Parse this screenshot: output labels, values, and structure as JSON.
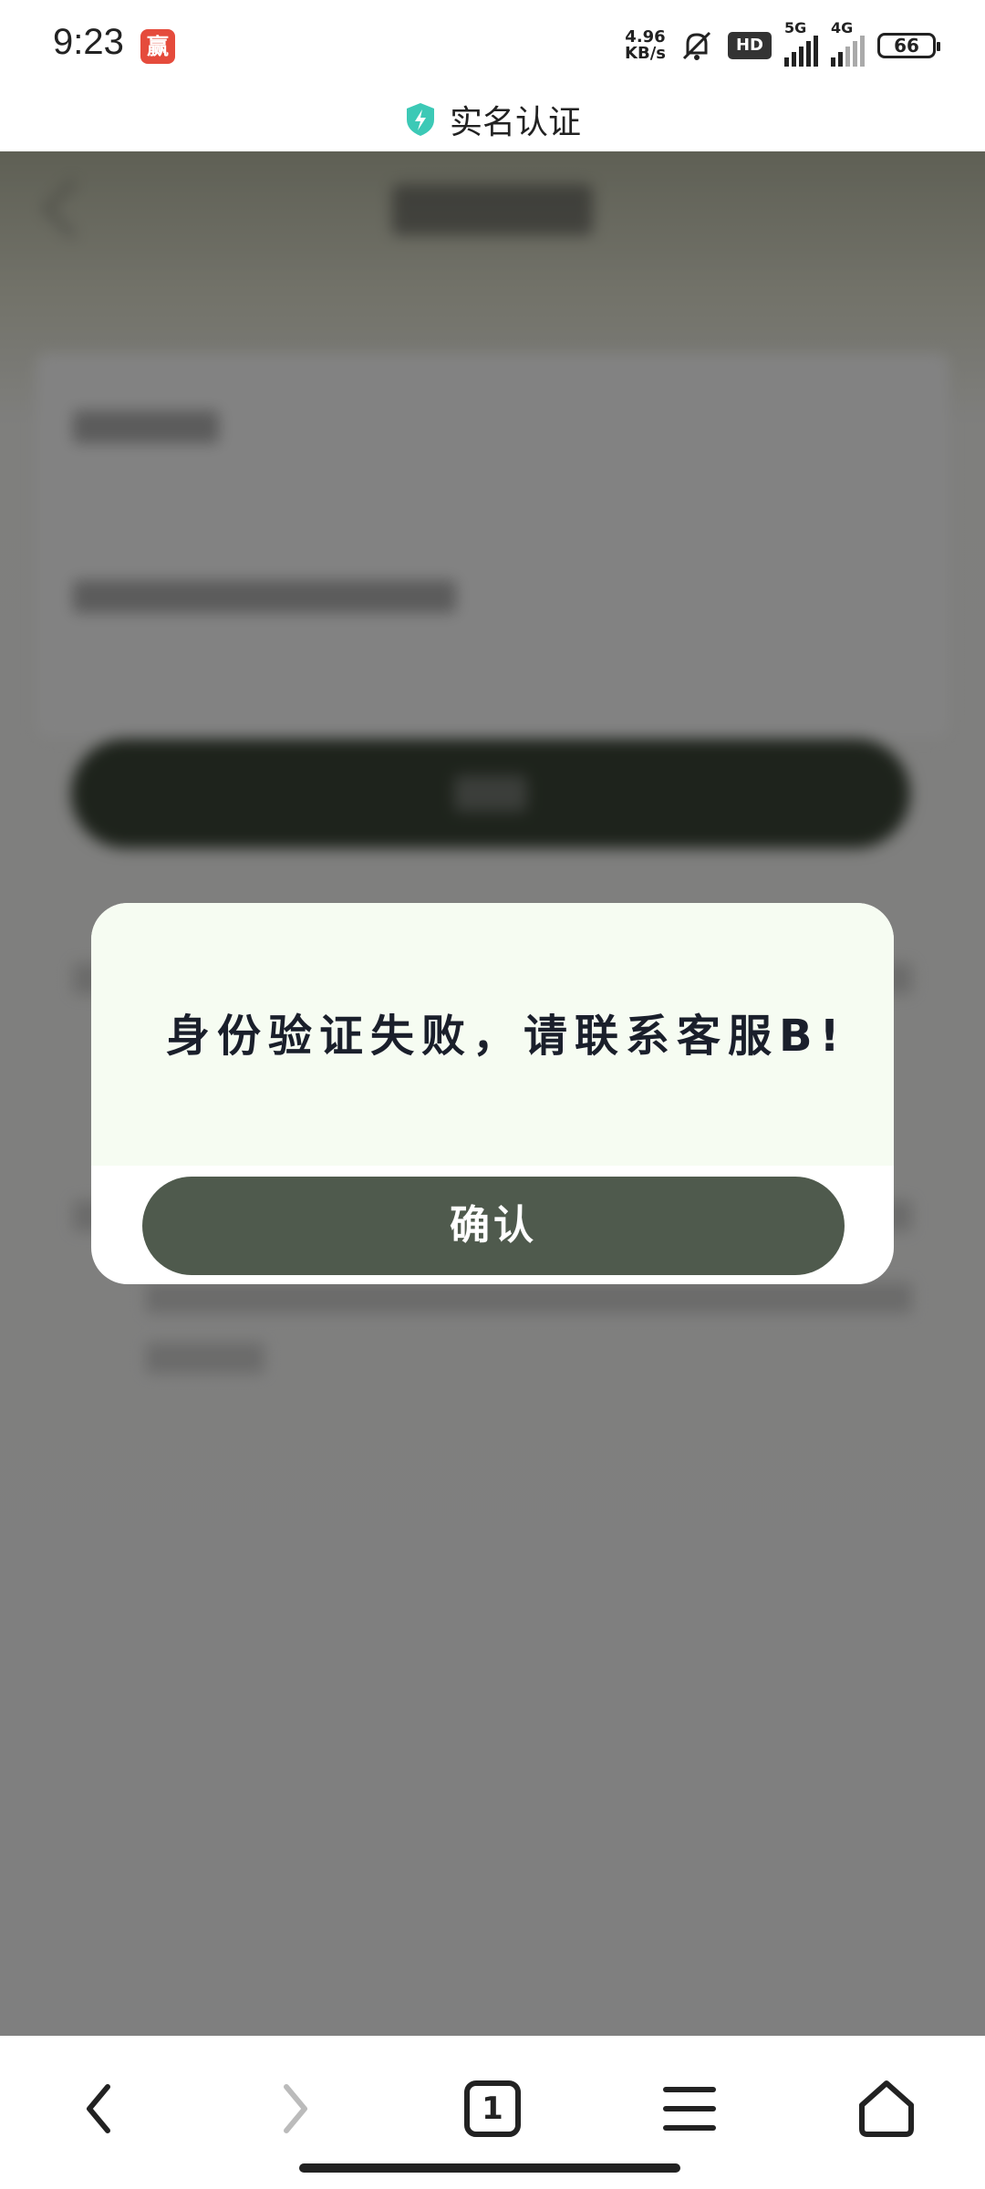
{
  "status_bar": {
    "time": "9:23",
    "app_badge": "赢",
    "net_speed_value": "4.96",
    "net_speed_unit": "KB/s",
    "hd_label": "HD",
    "sim1_label": "5G",
    "sim2_label": "4G",
    "battery": "66"
  },
  "titlebar": {
    "title": "实名认证",
    "shield_color": "#3cc9b6"
  },
  "dialog": {
    "message": "身份验证失败，请联系客服B!",
    "confirm_label": "确认",
    "confirm_color": "#4f5a4d"
  },
  "navbar": {
    "tab_count": "1"
  }
}
